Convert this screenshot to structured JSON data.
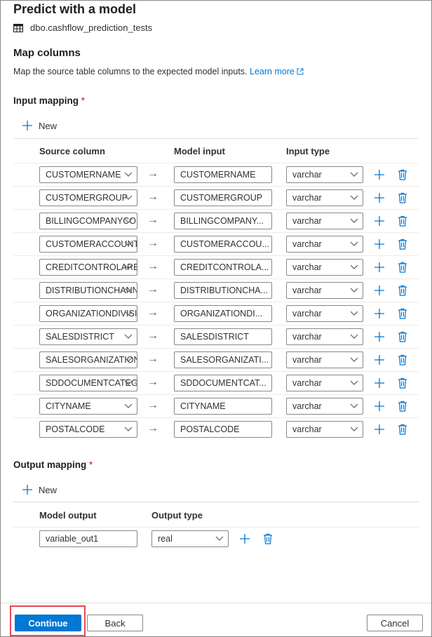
{
  "panel": {
    "title": "Predict with a model",
    "table_name": "dbo.cashflow_prediction_tests"
  },
  "map_columns": {
    "title": "Map columns",
    "description": "Map the source table columns to the expected model inputs.",
    "learn_more": "Learn more"
  },
  "input_mapping": {
    "label": "Input mapping",
    "required_mark": "*",
    "new_label": "New",
    "headers": {
      "source": "Source column",
      "model_input": "Model input",
      "input_type": "Input type"
    },
    "rows": [
      {
        "source": "CUSTOMERNAME",
        "model_input": "CUSTOMERNAME",
        "type": "varchar"
      },
      {
        "source": "CUSTOMERGROUP",
        "model_input": "CUSTOMERGROUP",
        "type": "varchar"
      },
      {
        "source": "BILLINGCOMPANYCOD",
        "model_input": "BILLINGCOMPANY...",
        "type": "varchar"
      },
      {
        "source": "CUSTOMERACCOUNTG",
        "model_input": "CUSTOMERACCOU...",
        "type": "varchar"
      },
      {
        "source": "CREDITCONTROLAREA",
        "model_input": "CREDITCONTROLA...",
        "type": "varchar"
      },
      {
        "source": "DISTRIBUTIONCHANN",
        "model_input": "DISTRIBUTIONCHA...",
        "type": "varchar"
      },
      {
        "source": "ORGANIZATIONDIVISIO",
        "model_input": "ORGANIZATIONDI...",
        "type": "varchar"
      },
      {
        "source": "SALESDISTRICT",
        "model_input": "SALESDISTRICT",
        "type": "varchar"
      },
      {
        "source": "SALESORGANIZATION",
        "model_input": "SALESORGANIZATI...",
        "type": "varchar"
      },
      {
        "source": "SDDOCUMENTCATEGO",
        "model_input": "SDDOCUMENTCAT...",
        "type": "varchar"
      },
      {
        "source": "CITYNAME",
        "model_input": "CITYNAME",
        "type": "varchar"
      },
      {
        "source": "POSTALCODE",
        "model_input": "POSTALCODE",
        "type": "varchar"
      }
    ]
  },
  "output_mapping": {
    "label": "Output mapping",
    "required_mark": "*",
    "new_label": "New",
    "headers": {
      "model_output": "Model output",
      "output_type": "Output type"
    },
    "rows": [
      {
        "model_output": "variable_out1",
        "type": "real"
      }
    ]
  },
  "footer": {
    "continue_label": "Continue",
    "back_label": "Back",
    "cancel_label": "Cancel"
  },
  "colors": {
    "accent": "#0078d4",
    "highlight": "#e74856"
  },
  "icons": {
    "table": "table-icon",
    "external": "external-link-icon",
    "add": "plus-icon",
    "delete": "trash-icon",
    "dropdown": "chevron-down-icon",
    "map": "right-arrow-icon"
  }
}
